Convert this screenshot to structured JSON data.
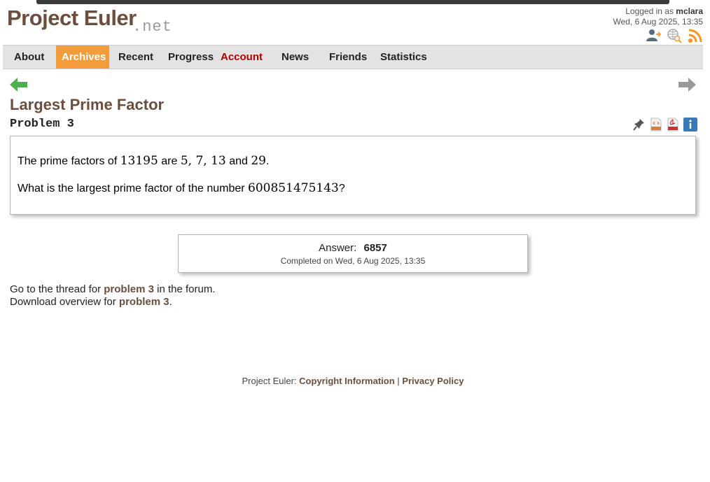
{
  "header": {
    "logo_main": "Project Euler",
    "logo_net": ".net",
    "logged_in_prefix": "Logged in as",
    "username": "mclara",
    "datetime": "Wed, 6 Aug 2025, 13:35"
  },
  "nav": {
    "about": "About",
    "archives": "Archives",
    "recent": "Recent",
    "progress": "Progress",
    "account": "Account",
    "news": "News",
    "friends": "Friends",
    "statistics": "Statistics"
  },
  "problem": {
    "title": "Largest Prime Factor",
    "number_label": "Problem 3",
    "p1_prefix": "The prime factors of",
    "p1_number": "13195",
    "p1_are": "are",
    "p1_factors": "5, 7, 13",
    "p1_and": "and",
    "p1_last": "29",
    "p1_end": ".",
    "p2_prefix": "What is the largest prime factor of the number",
    "p2_number": "600851475143",
    "p2_end": "?"
  },
  "answer": {
    "label": "Answer:",
    "value": "6857",
    "completed": "Completed on Wed, 6 Aug 2025, 13:35"
  },
  "links": {
    "thread_prefix": "Go to the thread for",
    "thread_link": "problem 3",
    "thread_suffix": "in the forum.",
    "download_prefix": "Download overview for",
    "download_link": "problem 3",
    "download_suffix": "."
  },
  "footer": {
    "prefix": "Project Euler:",
    "copyright": "Copyright Information",
    "separator": "|",
    "privacy": "Privacy Policy"
  },
  "icons": {
    "top": [
      "add-friend-icon",
      "globe-search-icon",
      "rss-icon"
    ],
    "tools": [
      "pin-icon",
      "html-icon",
      "pdf-icon",
      "info-icon"
    ],
    "nav_arrows": [
      "previous-arrow-icon",
      "next-arrow-icon"
    ]
  },
  "colors": {
    "brand_brown": "#6b4e3d",
    "active_tab": "#f39c3a",
    "account_red": "#b00000",
    "prev_arrow": "#4caf50",
    "next_arrow": "#999999",
    "rss_orange": "#f7931e"
  }
}
